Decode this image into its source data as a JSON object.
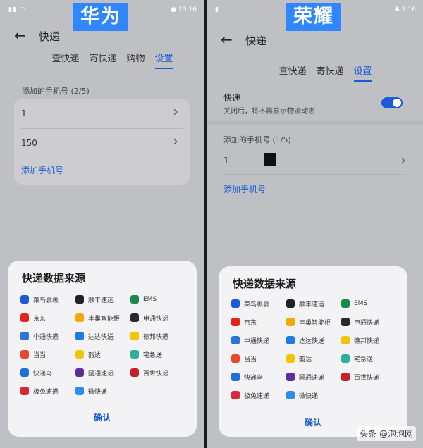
{
  "huawei": {
    "brand": "华为",
    "status_time": "13:16",
    "title": "快递",
    "tabs": [
      "查快递",
      "寄快递",
      "购物",
      "设置"
    ],
    "active_tab": "设置",
    "phone_section": "添加的手机号 (2/5)",
    "phones": [
      "1",
      "150"
    ],
    "add_phone": "添加手机号"
  },
  "honor": {
    "brand": "荣耀",
    "status_time": "1:16",
    "title": "快递",
    "tabs": [
      "查快递",
      "寄快递",
      "设置"
    ],
    "active_tab": "设置",
    "setting_title": "快递",
    "setting_desc": "关闭后，将不再显示物流动态",
    "phone_section": "添加的手机号 (1/5)",
    "phones": [
      "1"
    ],
    "add_phone": "添加手机号"
  },
  "sheet": {
    "title": "快递数据来源",
    "confirm": "确认",
    "sources": [
      {
        "name": "菜鸟裹裹",
        "icon": "cainiao-icon",
        "color": "#1c58d8"
      },
      {
        "name": "顺丰速运",
        "icon": "sf-icon",
        "color": "#222222"
      },
      {
        "name": "EMS",
        "icon": "ems-icon",
        "color": "#1a8a4a"
      },
      {
        "name": "京东",
        "icon": "jd-icon",
        "color": "#e1251b"
      },
      {
        "name": "丰巢智能柜",
        "icon": "fengchao-icon",
        "color": "#f2a900"
      },
      {
        "name": "申通快递",
        "icon": "sto-icon",
        "color": "#2a2a2a"
      },
      {
        "name": "中通快递",
        "icon": "zto-icon",
        "color": "#2e74d6"
      },
      {
        "name": "达达快送",
        "icon": "dada-icon",
        "color": "#1b7be0"
      },
      {
        "name": "德邦快递",
        "icon": "deppon-icon",
        "color": "#f5c400"
      },
      {
        "name": "当当",
        "icon": "dangdang-icon",
        "color": "#e64a2e"
      },
      {
        "name": "韵达",
        "icon": "yunda-icon",
        "color": "#f5c400"
      },
      {
        "name": "宅急送",
        "icon": "zjs-icon",
        "color": "#2bb0a0"
      },
      {
        "name": "快递鸟",
        "icon": "kdniao-icon",
        "color": "#1c72d8"
      },
      {
        "name": "圆通速递",
        "icon": "yto-icon",
        "color": "#5b2f9c"
      },
      {
        "name": "百世快递",
        "icon": "best-icon",
        "color": "#c8202a"
      },
      {
        "name": "极兔速递",
        "icon": "jitu-icon",
        "color": "#d7263d"
      },
      {
        "name": "微快递",
        "icon": "weikuaidi-icon",
        "color": "#2d8cf0"
      }
    ]
  },
  "watermark": "头条 @泡泡网"
}
